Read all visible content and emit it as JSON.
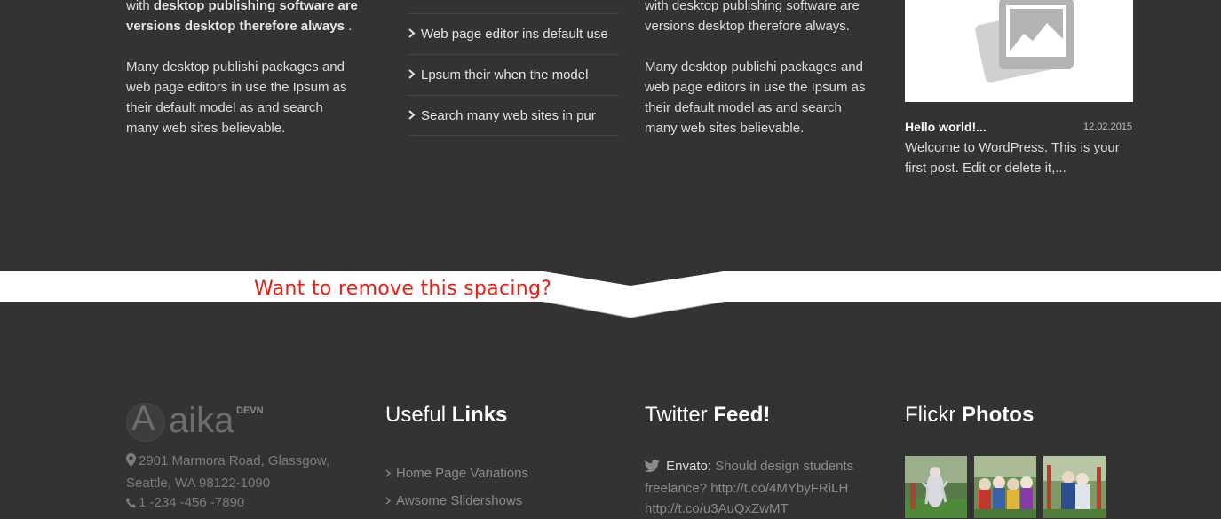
{
  "top": {
    "col1": {
      "line1_pre": "with ",
      "line1_bold": "desktop publishing software are",
      "line2_bold": "versions desktop therefore always",
      "line2_post": " .",
      "para2": "Many desktop publishi packages and web page editors in use the Ipsum as their default model as and search many web sites believable."
    },
    "links": [
      {
        "label": "Web page editor ins default use"
      },
      {
        "label": "Lpsum their when the model"
      },
      {
        "label": "Search many web sites in pur"
      }
    ],
    "col3": {
      "line1": "with desktop publishing software are",
      "line2": "versions desktop therefore always.",
      "para2": "Many desktop publishi packages and web page editors in use the Ipsum as their default model as and search many web sites believable."
    },
    "post": {
      "thumb_icon": "image-placeholder-icon",
      "title": "Hello world!...",
      "date": "12.02.2015",
      "excerpt": "Welcome to WordPress. This is your first post. Edit or delete it,..."
    }
  },
  "annotation": "Want to remove this spacing?",
  "footer": {
    "logo": {
      "initial": "A",
      "rest": "aika",
      "sup": "DEVN"
    },
    "address": "2901 Marmora Road, Glassgow, Seattle, WA 98122-1090",
    "phone": "1 -234 -456 -7890",
    "useful_links": {
      "title_light": "Useful ",
      "title_bold": "Links",
      "items": [
        {
          "label": "Home Page Variations"
        },
        {
          "label": "Awsome Slidershows"
        }
      ]
    },
    "twitter": {
      "title_light": "Twitter ",
      "title_bold": "Feed!",
      "author": "Envato:",
      "text": " Should design students freelance? http://t.co/4MYbyFRiLH http://t.co/u3AuQxZwMT"
    },
    "flickr": {
      "title_light": "Flickr ",
      "title_bold": "Photos"
    }
  },
  "colors": {
    "background": "#333333",
    "annotation": "#ee1c10",
    "divider": "#ffffff"
  }
}
